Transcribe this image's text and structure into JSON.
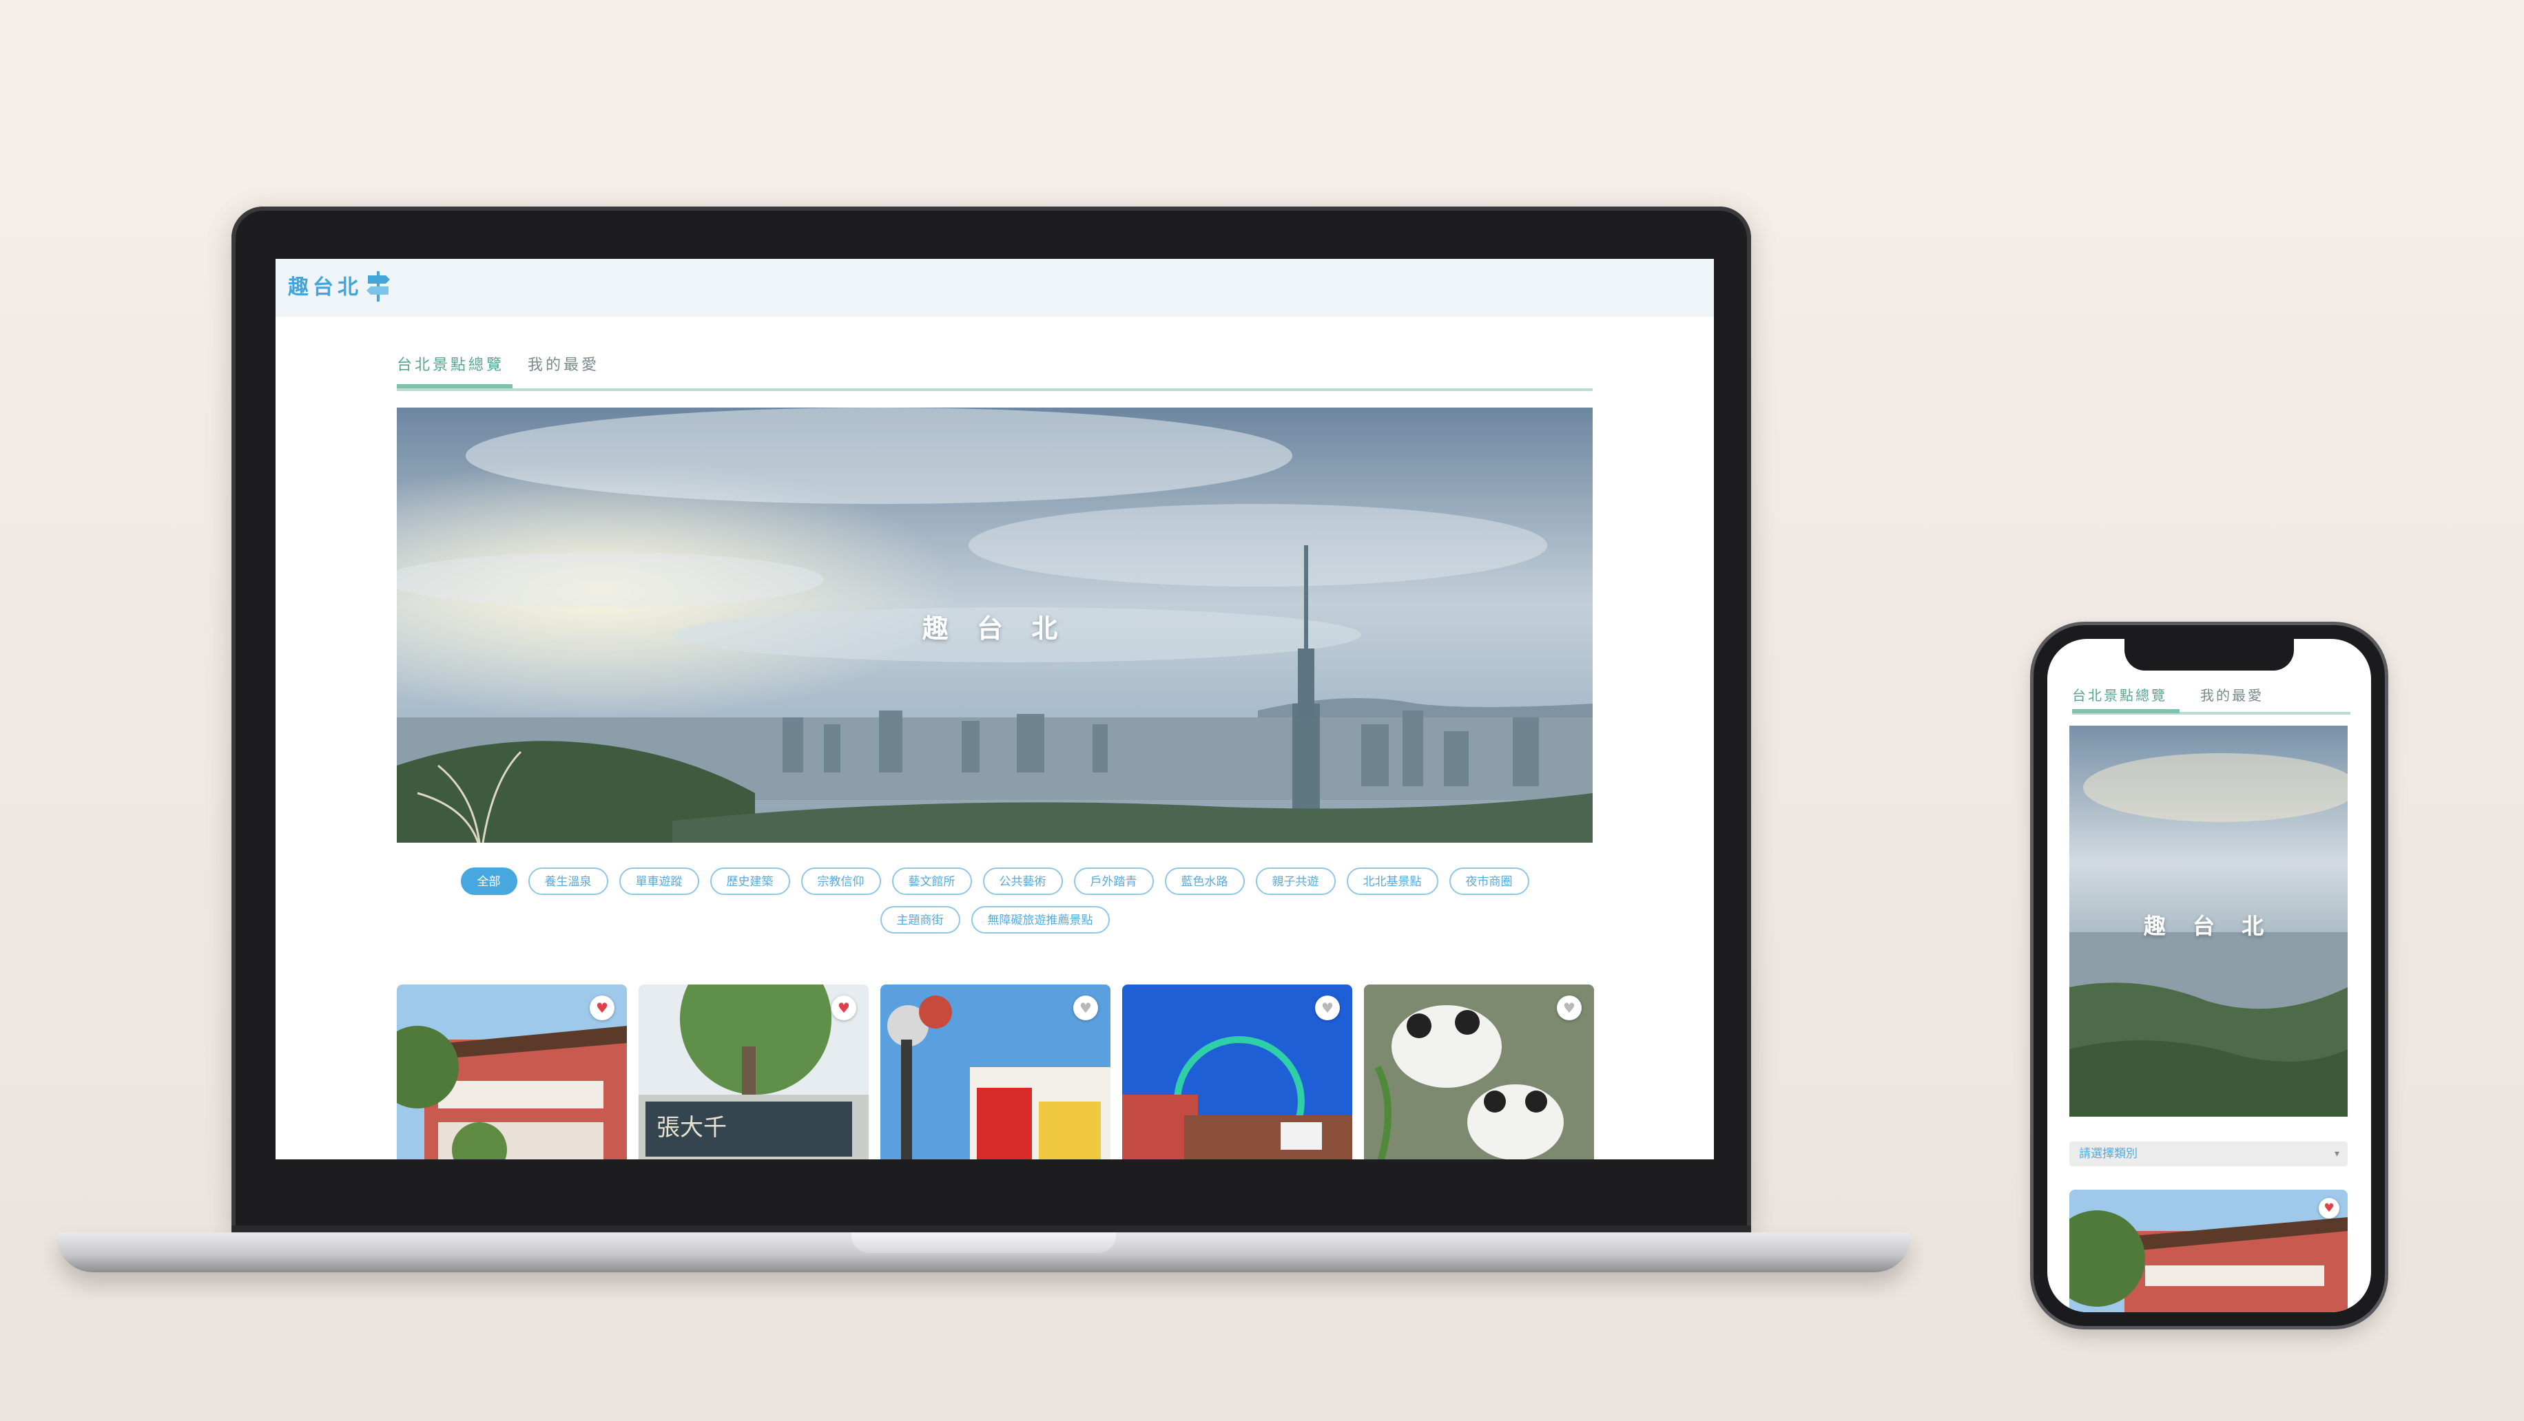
{
  "site": {
    "logo": "趣台北",
    "hero_title": "趣 台 北"
  },
  "tabs": [
    {
      "label": "台北景點總覽",
      "active": true
    },
    {
      "label": "我的最愛",
      "active": false
    }
  ],
  "filters": {
    "row1": [
      "全部",
      "養生溫泉",
      "單車遊蹤",
      "歷史建築",
      "宗教信仰",
      "藝文館所",
      "公共藝術",
      "戶外踏青",
      "藍色水路",
      "親子共遊",
      "北北基景點",
      "夜市商圈"
    ],
    "row2": [
      "主題商街",
      "無障礙旅遊推薦景點"
    ],
    "active": "全部"
  },
  "cards": [
    {
      "favorite": true
    },
    {
      "favorite": true
    },
    {
      "favorite": false
    },
    {
      "favorite": false
    },
    {
      "favorite": false
    }
  ],
  "cards_text": {
    "card2_sign": "張大千"
  },
  "mobile": {
    "select_placeholder": "請選擇類別"
  },
  "colors": {
    "accent": "#47a8e0",
    "tab_active": "#5aa58f",
    "favorite_heart": "#e0404a",
    "heart_inactive": "#b8b8b8"
  }
}
